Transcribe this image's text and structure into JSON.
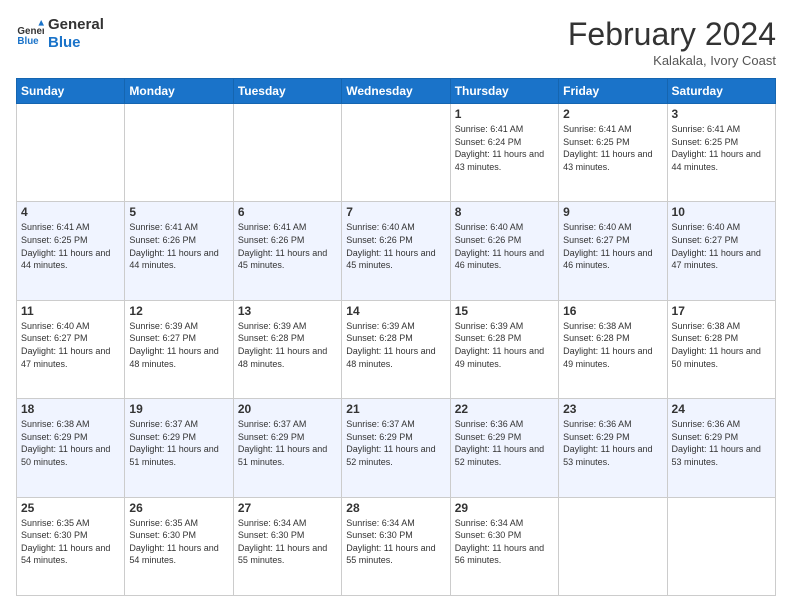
{
  "header": {
    "logo_line1": "General",
    "logo_line2": "Blue",
    "month_title": "February 2024",
    "location": "Kalakala, Ivory Coast"
  },
  "days_of_week": [
    "Sunday",
    "Monday",
    "Tuesday",
    "Wednesday",
    "Thursday",
    "Friday",
    "Saturday"
  ],
  "weeks": [
    [
      {
        "day": "",
        "info": ""
      },
      {
        "day": "",
        "info": ""
      },
      {
        "day": "",
        "info": ""
      },
      {
        "day": "",
        "info": ""
      },
      {
        "day": "1",
        "info": "Sunrise: 6:41 AM\nSunset: 6:24 PM\nDaylight: 11 hours and 43 minutes."
      },
      {
        "day": "2",
        "info": "Sunrise: 6:41 AM\nSunset: 6:25 PM\nDaylight: 11 hours and 43 minutes."
      },
      {
        "day": "3",
        "info": "Sunrise: 6:41 AM\nSunset: 6:25 PM\nDaylight: 11 hours and 44 minutes."
      }
    ],
    [
      {
        "day": "4",
        "info": "Sunrise: 6:41 AM\nSunset: 6:25 PM\nDaylight: 11 hours and 44 minutes."
      },
      {
        "day": "5",
        "info": "Sunrise: 6:41 AM\nSunset: 6:26 PM\nDaylight: 11 hours and 44 minutes."
      },
      {
        "day": "6",
        "info": "Sunrise: 6:41 AM\nSunset: 6:26 PM\nDaylight: 11 hours and 45 minutes."
      },
      {
        "day": "7",
        "info": "Sunrise: 6:40 AM\nSunset: 6:26 PM\nDaylight: 11 hours and 45 minutes."
      },
      {
        "day": "8",
        "info": "Sunrise: 6:40 AM\nSunset: 6:26 PM\nDaylight: 11 hours and 46 minutes."
      },
      {
        "day": "9",
        "info": "Sunrise: 6:40 AM\nSunset: 6:27 PM\nDaylight: 11 hours and 46 minutes."
      },
      {
        "day": "10",
        "info": "Sunrise: 6:40 AM\nSunset: 6:27 PM\nDaylight: 11 hours and 47 minutes."
      }
    ],
    [
      {
        "day": "11",
        "info": "Sunrise: 6:40 AM\nSunset: 6:27 PM\nDaylight: 11 hours and 47 minutes."
      },
      {
        "day": "12",
        "info": "Sunrise: 6:39 AM\nSunset: 6:27 PM\nDaylight: 11 hours and 48 minutes."
      },
      {
        "day": "13",
        "info": "Sunrise: 6:39 AM\nSunset: 6:28 PM\nDaylight: 11 hours and 48 minutes."
      },
      {
        "day": "14",
        "info": "Sunrise: 6:39 AM\nSunset: 6:28 PM\nDaylight: 11 hours and 48 minutes."
      },
      {
        "day": "15",
        "info": "Sunrise: 6:39 AM\nSunset: 6:28 PM\nDaylight: 11 hours and 49 minutes."
      },
      {
        "day": "16",
        "info": "Sunrise: 6:38 AM\nSunset: 6:28 PM\nDaylight: 11 hours and 49 minutes."
      },
      {
        "day": "17",
        "info": "Sunrise: 6:38 AM\nSunset: 6:28 PM\nDaylight: 11 hours and 50 minutes."
      }
    ],
    [
      {
        "day": "18",
        "info": "Sunrise: 6:38 AM\nSunset: 6:29 PM\nDaylight: 11 hours and 50 minutes."
      },
      {
        "day": "19",
        "info": "Sunrise: 6:37 AM\nSunset: 6:29 PM\nDaylight: 11 hours and 51 minutes."
      },
      {
        "day": "20",
        "info": "Sunrise: 6:37 AM\nSunset: 6:29 PM\nDaylight: 11 hours and 51 minutes."
      },
      {
        "day": "21",
        "info": "Sunrise: 6:37 AM\nSunset: 6:29 PM\nDaylight: 11 hours and 52 minutes."
      },
      {
        "day": "22",
        "info": "Sunrise: 6:36 AM\nSunset: 6:29 PM\nDaylight: 11 hours and 52 minutes."
      },
      {
        "day": "23",
        "info": "Sunrise: 6:36 AM\nSunset: 6:29 PM\nDaylight: 11 hours and 53 minutes."
      },
      {
        "day": "24",
        "info": "Sunrise: 6:36 AM\nSunset: 6:29 PM\nDaylight: 11 hours and 53 minutes."
      }
    ],
    [
      {
        "day": "25",
        "info": "Sunrise: 6:35 AM\nSunset: 6:30 PM\nDaylight: 11 hours and 54 minutes."
      },
      {
        "day": "26",
        "info": "Sunrise: 6:35 AM\nSunset: 6:30 PM\nDaylight: 11 hours and 54 minutes."
      },
      {
        "day": "27",
        "info": "Sunrise: 6:34 AM\nSunset: 6:30 PM\nDaylight: 11 hours and 55 minutes."
      },
      {
        "day": "28",
        "info": "Sunrise: 6:34 AM\nSunset: 6:30 PM\nDaylight: 11 hours and 55 minutes."
      },
      {
        "day": "29",
        "info": "Sunrise: 6:34 AM\nSunset: 6:30 PM\nDaylight: 11 hours and 56 minutes."
      },
      {
        "day": "",
        "info": ""
      },
      {
        "day": "",
        "info": ""
      }
    ]
  ]
}
